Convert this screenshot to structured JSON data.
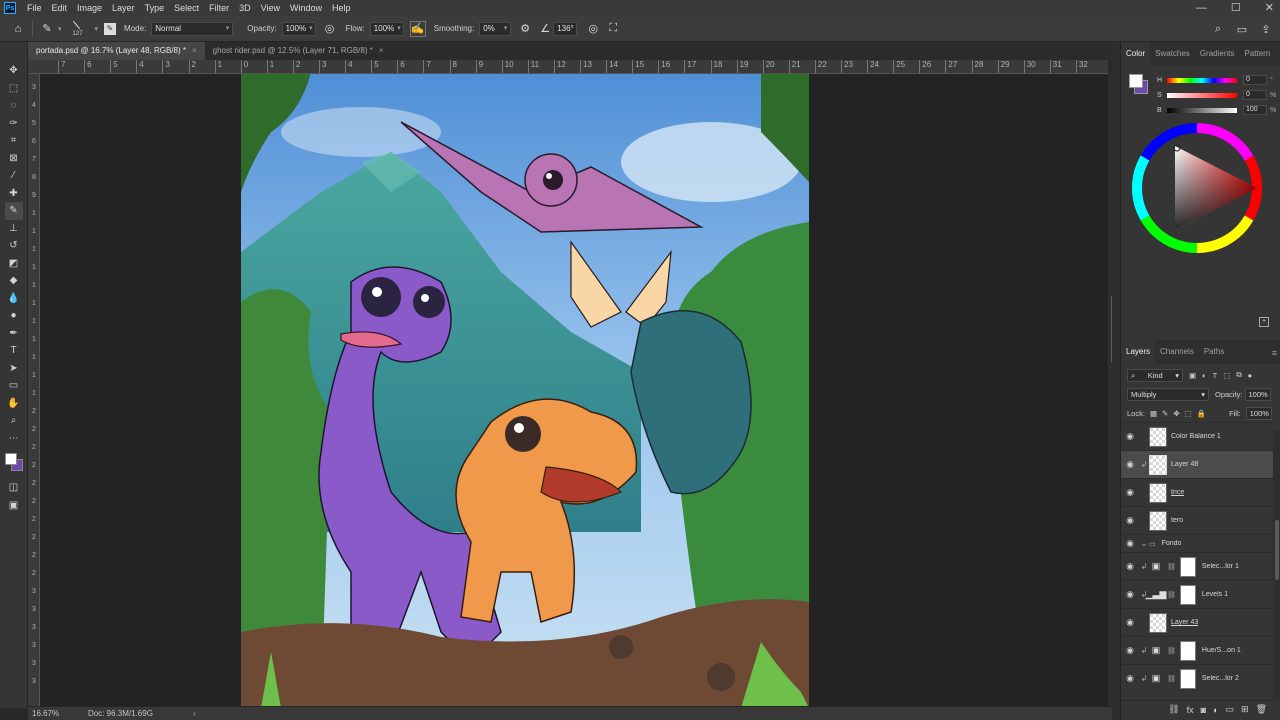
{
  "app": {
    "logo": "Ps"
  },
  "menu": [
    "File",
    "Edit",
    "Image",
    "Layer",
    "Type",
    "Select",
    "Filter",
    "3D",
    "View",
    "Window",
    "Help"
  ],
  "window_controls": {
    "minimize": "—",
    "maximize": "☐",
    "close": "✕"
  },
  "options_bar": {
    "brush_size": "127",
    "mode_label": "Mode:",
    "mode_value": "Normal",
    "opacity_label": "Opacity:",
    "opacity_value": "100%",
    "flow_label": "Flow:",
    "flow_value": "100%",
    "smoothing_label": "Smoothing:",
    "smoothing_value": "0%",
    "angle_value": "136°"
  },
  "tabs": [
    {
      "label": "portada.psd @ 16.7% (Layer 48, RGB/8) *",
      "close": "×"
    },
    {
      "label": "ghost rider.psd @ 12.5% (Layer 71, RGB/8) *",
      "close": "×"
    }
  ],
  "ruler": {
    "top": [
      "7",
      "6",
      "5",
      "4",
      "3",
      "2",
      "1",
      "0",
      "1",
      "2",
      "3",
      "4",
      "5",
      "6",
      "7",
      "8",
      "9",
      "10",
      "11",
      "12",
      "13",
      "14",
      "15",
      "16",
      "17",
      "18",
      "19",
      "20",
      "21",
      "22",
      "23",
      "24",
      "25",
      "26",
      "27",
      "28",
      "29",
      "30",
      "31",
      "32"
    ],
    "left": [
      "3",
      "4",
      "5",
      "6",
      "7",
      "8",
      "9",
      "1",
      "1",
      "1",
      "1",
      "1",
      "1",
      "1",
      "1",
      "1",
      "1",
      "1",
      "2",
      "2",
      "2",
      "2",
      "2",
      "2",
      "2",
      "2",
      "2",
      "2",
      "3",
      "3",
      "3",
      "3",
      "3",
      "3"
    ]
  },
  "status": {
    "zoom": "16.67%",
    "doc": "Doc: 96.3M/1.69G",
    "arrow": "›"
  },
  "color_panel": {
    "tabs": [
      "Color",
      "Swatches",
      "Gradients",
      "Pattern"
    ],
    "foreground": "#ffffff",
    "background": "#6b4aa8",
    "sliders": [
      {
        "label": "H",
        "value": "0",
        "unit": "°"
      },
      {
        "label": "S",
        "value": "0",
        "unit": "%"
      },
      {
        "label": "B",
        "value": "100",
        "unit": "%"
      }
    ]
  },
  "layers_panel": {
    "tabs": [
      "Layers",
      "Channels",
      "Paths"
    ],
    "filter_kind": "Kind",
    "blend_mode": "Multiply",
    "opacity_label": "Opacity:",
    "opacity_value": "100%",
    "lock_label": "Lock:",
    "fill_label": "Fill:",
    "fill_value": "100%",
    "layers": [
      {
        "name": "Color Balance 1",
        "type": "adjust",
        "selected": false
      },
      {
        "name": "Layer 48",
        "type": "pixel-clip",
        "selected": true
      },
      {
        "name": "trice",
        "type": "pixel",
        "selected": false,
        "underline": true
      },
      {
        "name": "tero",
        "type": "pixel",
        "selected": false
      },
      {
        "name": "Fondo",
        "type": "group",
        "selected": false
      },
      {
        "name": "Selec...lor 1",
        "type": "adj-mask",
        "selected": false
      },
      {
        "name": "Levels 1",
        "type": "adj-mask",
        "selected": false
      },
      {
        "name": "Layer 43",
        "type": "pixel",
        "selected": false,
        "underline": true
      },
      {
        "name": "Hue/S...on 1",
        "type": "adj-mask",
        "selected": false
      },
      {
        "name": "Selec...lor 2",
        "type": "adj-mask",
        "selected": false
      }
    ]
  }
}
